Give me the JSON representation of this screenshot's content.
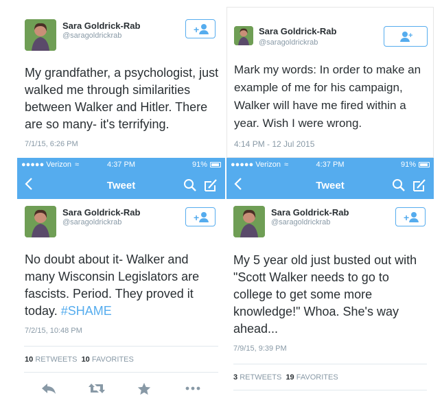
{
  "profile": {
    "name": "Sara Goldrick-Rab",
    "handle": "@saragoldrickrab"
  },
  "colors": {
    "accent": "#55acee",
    "muted": "#8899a6",
    "text": "#292f33"
  },
  "tweets": [
    {
      "text": "My grandfather, a psychologist, just walked me through similarities between Walker and Hitler. There are so many- it's terrifying.",
      "date": "7/1/15, 6:26 PM"
    },
    {
      "text": "Mark my words: In order to make an example of me for his campaign, Walker will have me fired within a year. Wish I were wrong.",
      "date": "4:14 PM - 12 Jul 2015"
    },
    {
      "text": "No doubt about it- Walker and many Wisconsin Legislators are fascists. Period. They proved it today.",
      "hashtag": "#SHAME",
      "date": "7/2/15, 10:48 PM",
      "retweets": "10",
      "retweets_label": "RETWEETS",
      "favorites": "10",
      "favorites_label": "FAVORITES"
    },
    {
      "text": "My 5 year old just busted out with \"Scott Walker needs to go to college to get some more knowledge!\"  Whoa. She's way ahead...",
      "date": "7/9/15, 9:39 PM",
      "retweets": "3",
      "retweets_label": "RETWEETS",
      "favorites": "19",
      "favorites_label": "FAVORITES"
    }
  ],
  "phone": {
    "carrier": "●●●●● Verizon",
    "time": "4:37 PM",
    "battery": "91%",
    "title": "Tweet",
    "back": "<"
  },
  "icons": [
    "follow-icon",
    "back-icon",
    "search-icon",
    "compose-icon",
    "reply-icon",
    "retweet-icon",
    "favorite-icon",
    "more-icon",
    "wifi-icon",
    "battery-icon"
  ]
}
